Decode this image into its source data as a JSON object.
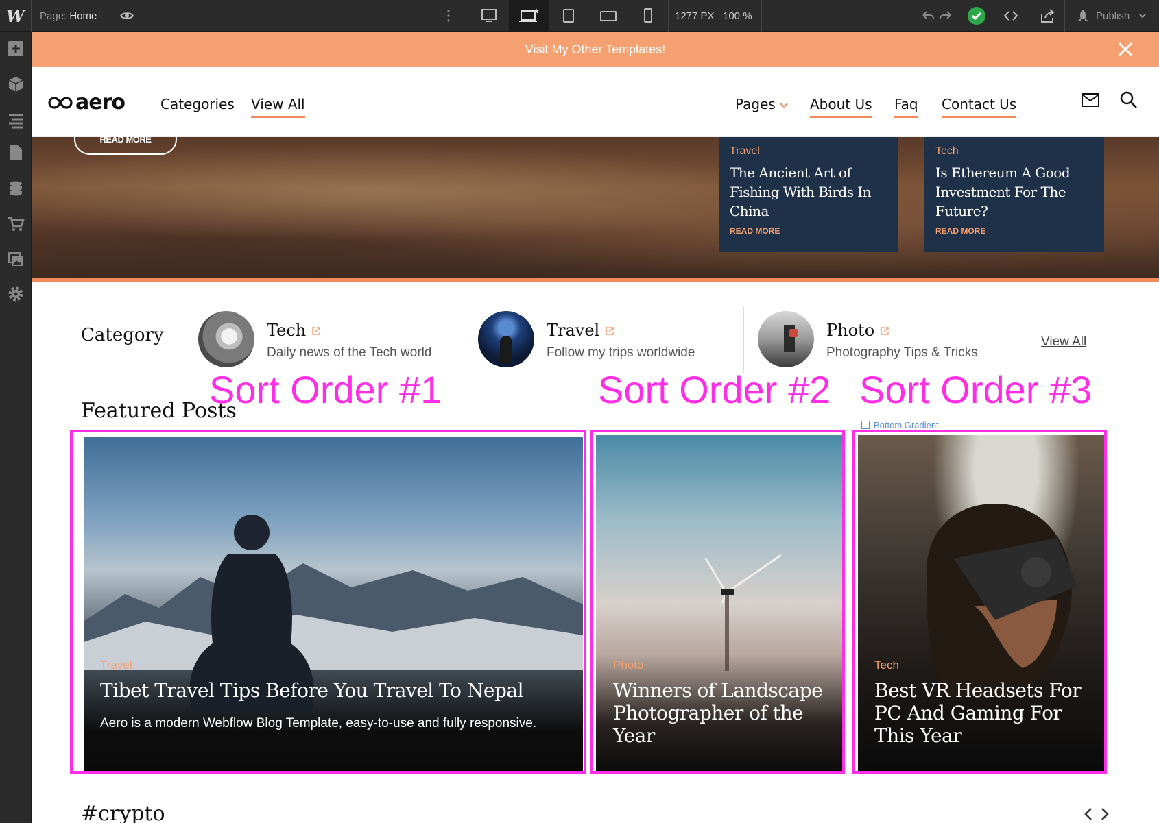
{
  "toolbar": {
    "logo": "W",
    "page_label": "Page:",
    "page_name": "Home",
    "width": "1277 PX",
    "zoom": "100 %",
    "publish": "Publish"
  },
  "banner": {
    "text": "Visit My Other Templates!"
  },
  "nav": {
    "logo_text": "aero",
    "left_links": [
      "Categories",
      "View All"
    ],
    "right_links": [
      "Pages",
      "About Us",
      "Faq",
      "Contact Us"
    ]
  },
  "hero": {
    "read_more": "READ MORE",
    "cards": [
      {
        "category": "Travel",
        "title": "The Ancient Art of Fishing With Birds In China",
        "more": "READ MORE"
      },
      {
        "category": "Tech",
        "title": "Is Ethereum A Good Investment For The Future?",
        "more": "READ MORE"
      }
    ]
  },
  "category_section": {
    "title": "Category",
    "items": [
      {
        "name": "Tech",
        "desc": "Daily news of the Tech world"
      },
      {
        "name": "Travel",
        "desc": "Follow my trips worldwide"
      },
      {
        "name": "Photo",
        "desc": "Photography Tips & Tricks"
      }
    ],
    "view_all": "View All"
  },
  "annotations": {
    "sort1": "Sort Order #1",
    "sort2": "Sort Order #2",
    "sort3": "Sort Order #3",
    "gradient_label": "Bottom Gradient"
  },
  "featured": {
    "title": "Featured Posts",
    "posts": [
      {
        "category": "Travel",
        "title": "Tibet Travel Tips Before You Travel To Nepal",
        "desc": "Aero is a modern Webflow Blog Template, easy-to-use and fully responsive."
      },
      {
        "category": "Photo",
        "title": "Winners of Landscape Photographer of the Year"
      },
      {
        "category": "Tech",
        "title": "Best VR Headsets For PC And Gaming For This Year"
      }
    ]
  },
  "next_section": {
    "title": "#crypto"
  },
  "colors": {
    "accent": "#f4a070",
    "annotation": "#ff2ee6",
    "card_navy": "#1f3148"
  }
}
